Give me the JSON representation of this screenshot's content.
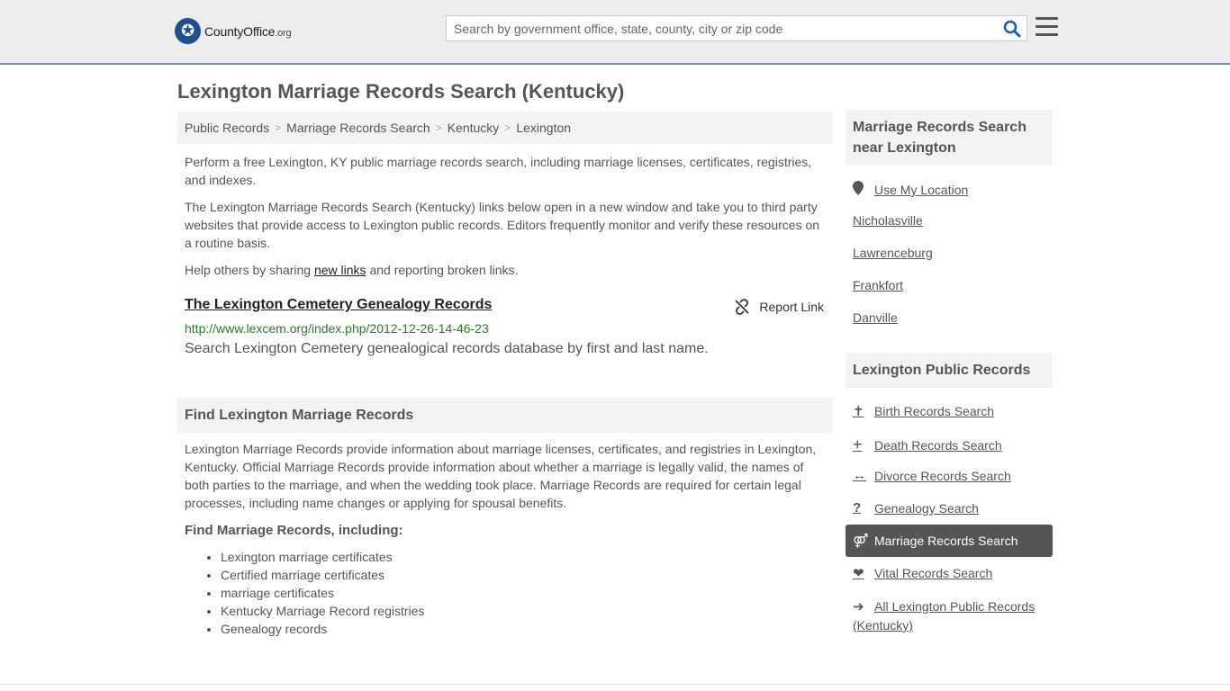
{
  "header": {
    "logo_main": "CountyOffice",
    "logo_suffix": ".org",
    "search_placeholder": "Search by government office, state, county, city or zip code"
  },
  "page": {
    "title": "Lexington Marriage Records Search (Kentucky)"
  },
  "breadcrumb": [
    "Public Records",
    "Marriage Records Search",
    "Kentucky",
    "Lexington"
  ],
  "intro": {
    "p1": "Perform a free Lexington, KY public marriage records search, including marriage licenses, certificates, registries, and indexes.",
    "p2": "The Lexington Marriage Records Search (Kentucky) links below open in a new window and take you to third party websites that provide access to Lexington public records. Editors frequently monitor and verify these resources on a routine basis.",
    "p3_before": "Help others by sharing ",
    "p3_link": "new links",
    "p3_after": " and reporting broken links."
  },
  "result": {
    "title": "The Lexington Cemetery Genealogy Records",
    "url": "http://www.lexcem.org/index.php/2012-12-26-14-46-23",
    "description": "Search Lexington Cemetery genealogical records database by first and last name.",
    "report_label": "Report Link"
  },
  "find_section": {
    "heading": "Find Lexington Marriage Records",
    "body": "Lexington Marriage Records provide information about marriage licenses, certificates, and registries in Lexington, Kentucky. Official Marriage Records provide information about whether a marriage is legally valid, the names of both parties to the marriage, and when the wedding took place. Marriage Records are required for certain legal processes, including name changes or applying for spousal benefits.",
    "subheading": "Find Marriage Records, including:",
    "items": [
      "Lexington marriage certificates",
      "Certified marriage certificates",
      "marriage certificates",
      "Kentucky Marriage Record registries",
      "Genealogy records"
    ]
  },
  "sidebar": {
    "nearby_heading": "Marriage Records Search near Lexington",
    "use_location": "Use My Location",
    "nearby": [
      "Nicholasville",
      "Lawrenceburg",
      "Frankfort",
      "Danville"
    ],
    "public_heading": "Lexington Public Records",
    "public_links": [
      {
        "label": "Birth Records Search",
        "icon": "baby-icon"
      },
      {
        "label": "Death Records Search",
        "icon": "cross-icon"
      },
      {
        "label": "Divorce Records Search",
        "icon": "split-arrows-icon"
      },
      {
        "label": "Genealogy Search",
        "icon": "question-icon"
      },
      {
        "label": "Marriage Records Search",
        "icon": "venus-mars-icon"
      },
      {
        "label": "Vital Records Search",
        "icon": "heartbeat-icon"
      }
    ],
    "all_records": "All Lexington Public Records (Kentucky)"
  }
}
